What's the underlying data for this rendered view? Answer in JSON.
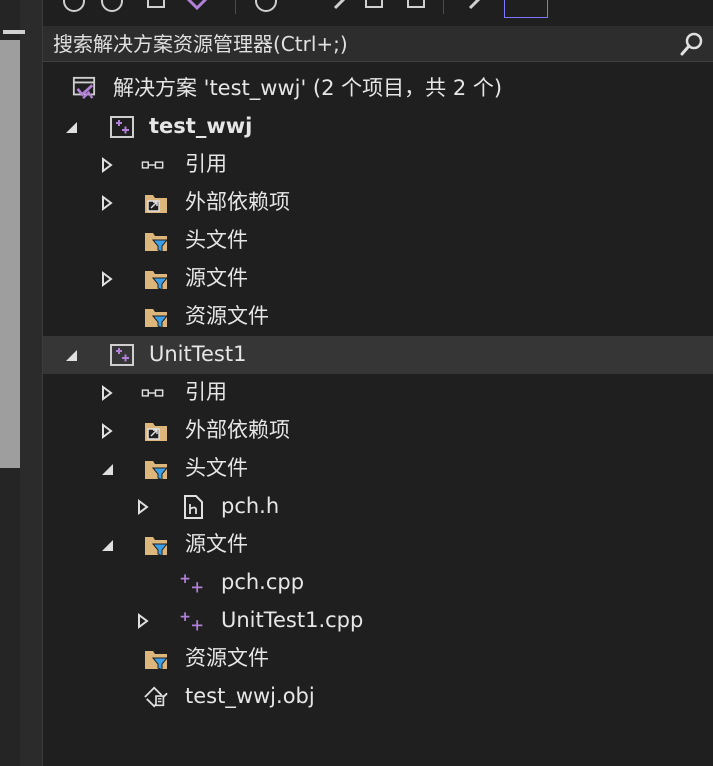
{
  "search": {
    "placeholder": "搜索解决方案资源管理器(Ctrl+;)"
  },
  "tree": {
    "solution": "解决方案 'test_wwj' (2 个项目，共 2 个)",
    "project1": {
      "name": "test_wwj",
      "references": "引用",
      "external_deps": "外部依赖项",
      "header_files": "头文件",
      "source_files": "源文件",
      "resource_files": "资源文件"
    },
    "project2": {
      "name": "UnitTest1",
      "references": "引用",
      "external_deps": "外部依赖项",
      "header_files": "头文件",
      "pch_h": "pch.h",
      "source_files": "源文件",
      "pch_cpp": "pch.cpp",
      "unittest_cpp": "UnitTest1.cpp",
      "resource_files": "资源文件",
      "obj_file": "test_wwj.obj"
    }
  },
  "colors": {
    "accent": "#b180d7",
    "filter_blue": "#3b9fe8",
    "folder": "#dcb67a",
    "selected_row": "#363636"
  }
}
